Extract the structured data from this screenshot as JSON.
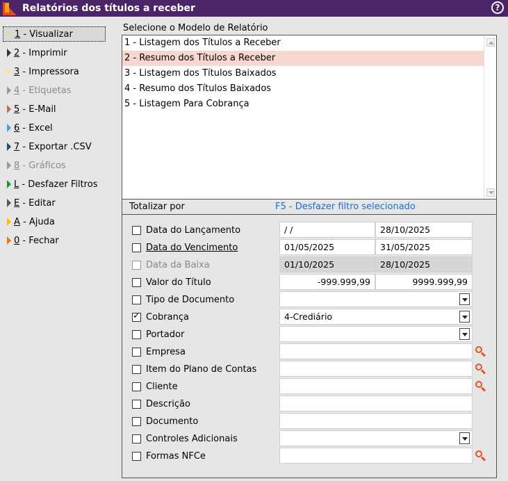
{
  "window": {
    "title": "Relatórios dos títulos a receber"
  },
  "sidebar": {
    "items": [
      {
        "key": "1",
        "label": " - Visualizar",
        "color": "#cfe8a0",
        "disabled": false
      },
      {
        "key": "2",
        "label": " - Imprimir",
        "color": "#333333",
        "disabled": false
      },
      {
        "key": "3",
        "label": " - Impressora",
        "color": "#f6e49a",
        "disabled": false
      },
      {
        "key": "4",
        "label": " - Etiquetas",
        "color": "#9a9a9a",
        "disabled": true
      },
      {
        "key": "5",
        "label": " - E-Mail",
        "color": "#b07070",
        "disabled": false
      },
      {
        "key": "6",
        "label": " - Excel",
        "color": "#4aa0e0",
        "disabled": false
      },
      {
        "key": "7",
        "label": " - Exportar .CSV",
        "color": "#2a4a6a",
        "disabled": false
      },
      {
        "key": "8",
        "label": " - Gráficos",
        "color": "#9a9a9a",
        "disabled": true
      },
      {
        "key": "L",
        "label": " - Desfazer Filtros",
        "color": "#1e9a2a",
        "disabled": false
      },
      {
        "key": "E",
        "label": " - Editar",
        "color": "#555555",
        "disabled": false
      },
      {
        "key": "A",
        "label": " - Ajuda",
        "color": "#f2c400",
        "disabled": false
      },
      {
        "key": "0",
        "label": " - Fechar",
        "color": "#f07020",
        "disabled": false
      }
    ]
  },
  "models": {
    "label": "Selecione o Modelo de Relatório",
    "items": [
      "1 - Listagem dos Títulos a Receber",
      "2 - Resumo dos Títulos a Receber",
      "3 - Listagem dos Títulos Baixados",
      "4 - Resumo dos Títulos Baixados",
      "5 - Listagem Para Cobrança"
    ],
    "selected_index": 1
  },
  "filters": {
    "header_left": "Totalizar por",
    "header_right": "F5 - Desfazer filtro selecionado",
    "rows": [
      {
        "label": "Data do Lançamento",
        "checked": false,
        "from": " /  /",
        "to": "28/10/2025"
      },
      {
        "label": "Data do Vencimento",
        "checked": false,
        "from": "01/05/2025",
        "to": "31/05/2025"
      },
      {
        "label": "Data da Baixa",
        "checked": false,
        "from": "01/10/2025",
        "to": "28/10/2025"
      },
      {
        "label": "Valor do Título",
        "checked": false,
        "from": "-999.999,99",
        "to": "9999.999,99"
      },
      {
        "label": "Tipo de Documento",
        "checked": false,
        "value": ""
      },
      {
        "label": "Cobrança",
        "checked": true,
        "value": "4-Crediário"
      },
      {
        "label": "Portador",
        "checked": false,
        "value": ""
      },
      {
        "label": "Empresa",
        "checked": false,
        "value": ""
      },
      {
        "label": "Item do Plano de Contas",
        "checked": false,
        "value": ""
      },
      {
        "label": "Cliente",
        "checked": false,
        "value": ""
      },
      {
        "label": "Descrição",
        "checked": false,
        "value": ""
      },
      {
        "label": "Documento",
        "checked": false,
        "value": ""
      },
      {
        "label": "Controles Adicionais",
        "checked": false,
        "value": ""
      },
      {
        "label": "Formas NFCe",
        "checked": false,
        "value": ""
      }
    ]
  },
  "colors": {
    "titlebar": "#4a2466",
    "selected_row": "#f7d7d0",
    "link": "#1a6fd0",
    "search_icon": "#e8502a"
  }
}
